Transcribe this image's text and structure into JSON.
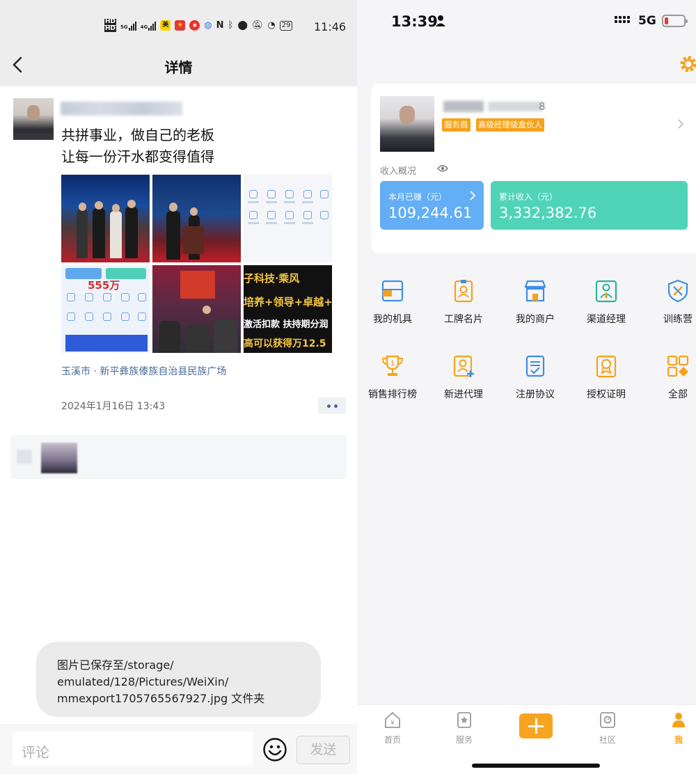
{
  "left": {
    "status_bar": {
      "time": "11:46",
      "network_1": "HD",
      "network_2": "HD",
      "signal_1": "5G",
      "signal_2": "4G",
      "app_badge_1": "美",
      "battery": "29"
    },
    "header": {
      "title": "详情"
    },
    "post": {
      "text_line_1": "共拼事业，做自己的老板",
      "text_line_2": "让每一份汗水都变得值得",
      "images": {
        "tile4_number": "555万",
        "tile6_lines": [
          "子科技·乘风",
          "培养+领导+卓越+",
          "激活扣款 扶持期分润",
          "高可以获得万12.5"
        ]
      },
      "location": "玉溪市 · 新平彝族傣族自治县民族广场",
      "date": "2024年1月16日 13:43"
    },
    "toast": {
      "line_1": "图片已保存至/storage/",
      "line_2": "emulated/128/Pictures/WeiXin/",
      "line_3": "mmexport1705765567927.jpg 文件夹"
    },
    "comment_bar": {
      "placeholder": "评论",
      "send_label": "发送"
    }
  },
  "right": {
    "status_bar": {
      "time": "13:39",
      "network": "5G"
    },
    "profile": {
      "phone_suffix": "8",
      "tags": [
        "服务商",
        "高级经理级盒伙人"
      ],
      "income_overview_label": "收入概况",
      "month_label": "本月已赚（元）",
      "month_value": "109,244.61",
      "total_label": "累计收入（元）",
      "total_value": "3,332,382.76"
    },
    "menu": [
      {
        "label": "我的机具",
        "icon": "device-icon"
      },
      {
        "label": "工牌名片",
        "icon": "badge-card-icon"
      },
      {
        "label": "我的商户",
        "icon": "store-icon"
      },
      {
        "label": "渠道经理",
        "icon": "manager-icon"
      },
      {
        "label": "训练营",
        "icon": "shield-icon"
      },
      {
        "label": "销售排行榜",
        "icon": "trophy-icon"
      },
      {
        "label": "新进代理",
        "icon": "add-agent-icon"
      },
      {
        "label": "注册协议",
        "icon": "agreement-icon"
      },
      {
        "label": "授权证明",
        "icon": "certificate-icon"
      },
      {
        "label": "全部",
        "icon": "all-grid-icon"
      }
    ],
    "tabbar": [
      {
        "label": "首页",
        "icon": "home-icon"
      },
      {
        "label": "服务",
        "icon": "service-icon"
      },
      {
        "label": "社区",
        "icon": "community-icon"
      },
      {
        "label": "我",
        "icon": "me-icon"
      }
    ],
    "colors": {
      "accent": "#f5a21b",
      "blue_box": "#63aef4",
      "teal_box": "#4fd4b8",
      "icon_blue": "#3d8ee6"
    }
  }
}
